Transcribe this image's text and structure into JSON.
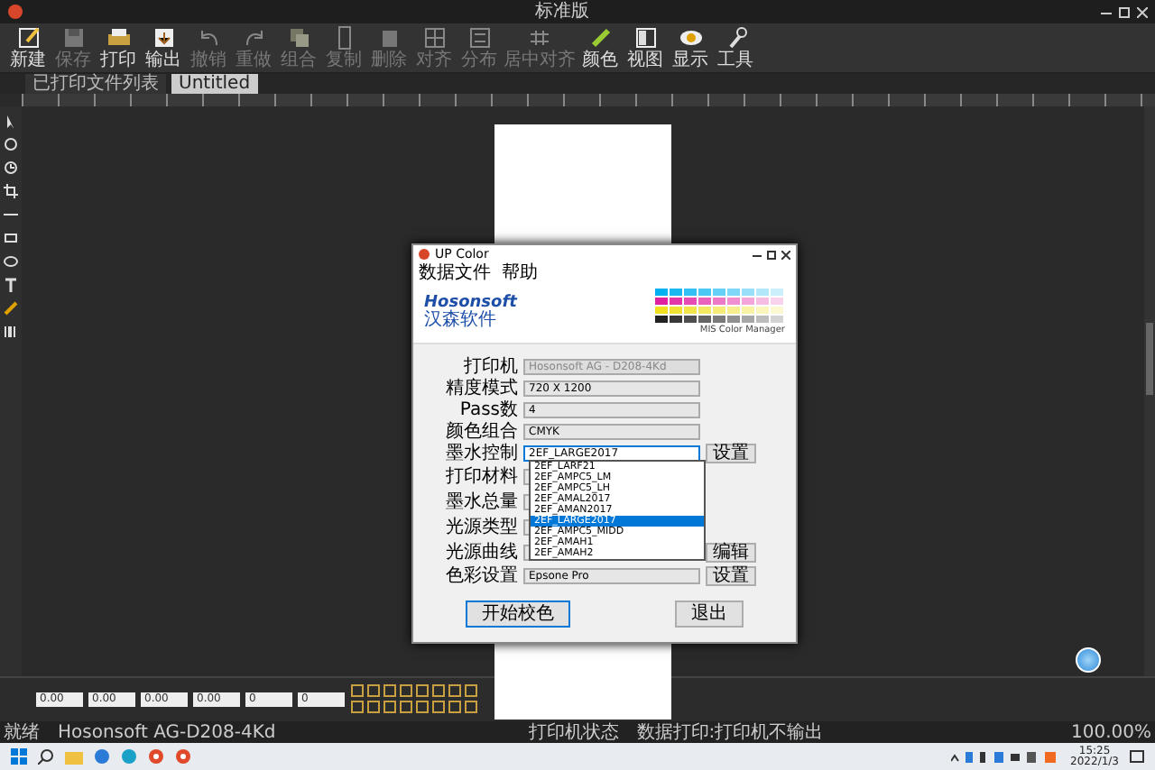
{
  "window": {
    "title": "标准版"
  },
  "toolbar": [
    {
      "label": "新建",
      "disabled": false
    },
    {
      "label": "保存",
      "disabled": true
    },
    {
      "label": "打印",
      "disabled": false
    },
    {
      "label": "输出",
      "disabled": false
    },
    {
      "label": "撤销",
      "disabled": true
    },
    {
      "label": "重做",
      "disabled": true
    },
    {
      "label": "组合",
      "disabled": true
    },
    {
      "label": "复制",
      "disabled": true
    },
    {
      "label": "删除",
      "disabled": true
    },
    {
      "label": "对齐",
      "disabled": true
    },
    {
      "label": "分布",
      "disabled": true
    },
    {
      "label": "居中对齐",
      "disabled": true
    },
    {
      "label": "颜色",
      "disabled": false
    },
    {
      "label": "视图",
      "disabled": false
    },
    {
      "label": "显示",
      "disabled": false
    },
    {
      "label": "工具",
      "disabled": false
    }
  ],
  "tabs": [
    {
      "label": "已打印文件列表",
      "selected": false
    },
    {
      "label": "Untitled",
      "selected": true
    }
  ],
  "dialog": {
    "title": "UP Color",
    "menu": [
      "数据文件",
      "帮助"
    ],
    "brand": "Hosonsoft",
    "brand_sub": "汉森软件",
    "banner_caption": "MIS Color Manager",
    "fields": [
      {
        "label": "打印机",
        "value": "Hosonsoft AG - D208-4Kd",
        "disabled": true
      },
      {
        "label": "精度模式",
        "value": "720 X 1200",
        "disabled": false
      },
      {
        "label": "Pass数",
        "value": "4",
        "disabled": false
      },
      {
        "label": "颜色组合",
        "value": "CMYK",
        "disabled": false
      },
      {
        "label": "墨水控制",
        "value": "2EF_LARGE2017",
        "disabled": false,
        "button": "设置"
      },
      {
        "label": "打印材料"
      },
      {
        "label": "墨水总量"
      },
      {
        "label": "光源类型"
      },
      {
        "label": "光源曲线",
        "button": "编辑"
      },
      {
        "label": "色彩设置",
        "value": "Epsone Pro",
        "disabled": false,
        "button": "设置"
      }
    ],
    "dropdown": {
      "items": [
        {
          "label": "2EF_LARF21",
          "selected": false
        },
        {
          "label": "2EF_AMPC5_LM",
          "selected": false
        },
        {
          "label": "2EF_AMPC5_LH",
          "selected": false
        },
        {
          "label": "2EF_AMAL2017",
          "selected": false
        },
        {
          "label": "2EF_AMAN2017",
          "selected": false
        },
        {
          "label": "2EF_LARGE2017",
          "selected": true
        },
        {
          "label": "2EF_AMPC5_MIDD",
          "selected": false
        },
        {
          "label": "2EF_AMAH1",
          "selected": false
        },
        {
          "label": "2EF_AMAH2",
          "selected": false
        }
      ]
    },
    "buttons": [
      "开始校色",
      "退出"
    ]
  },
  "bottom_panel": {
    "values": [
      "0.00",
      "0.00",
      "0.00",
      "0.00",
      "0",
      "0"
    ]
  },
  "status_bar": {
    "left": "就绪",
    "printer": "Hosonsoft AG-D208-4Kd",
    "center": "打印机状态",
    "message": "数据打印:打印机不输出",
    "zoom": "100.00%"
  },
  "taskbar": {
    "time": "15:25",
    "date": "2022/1/3"
  }
}
